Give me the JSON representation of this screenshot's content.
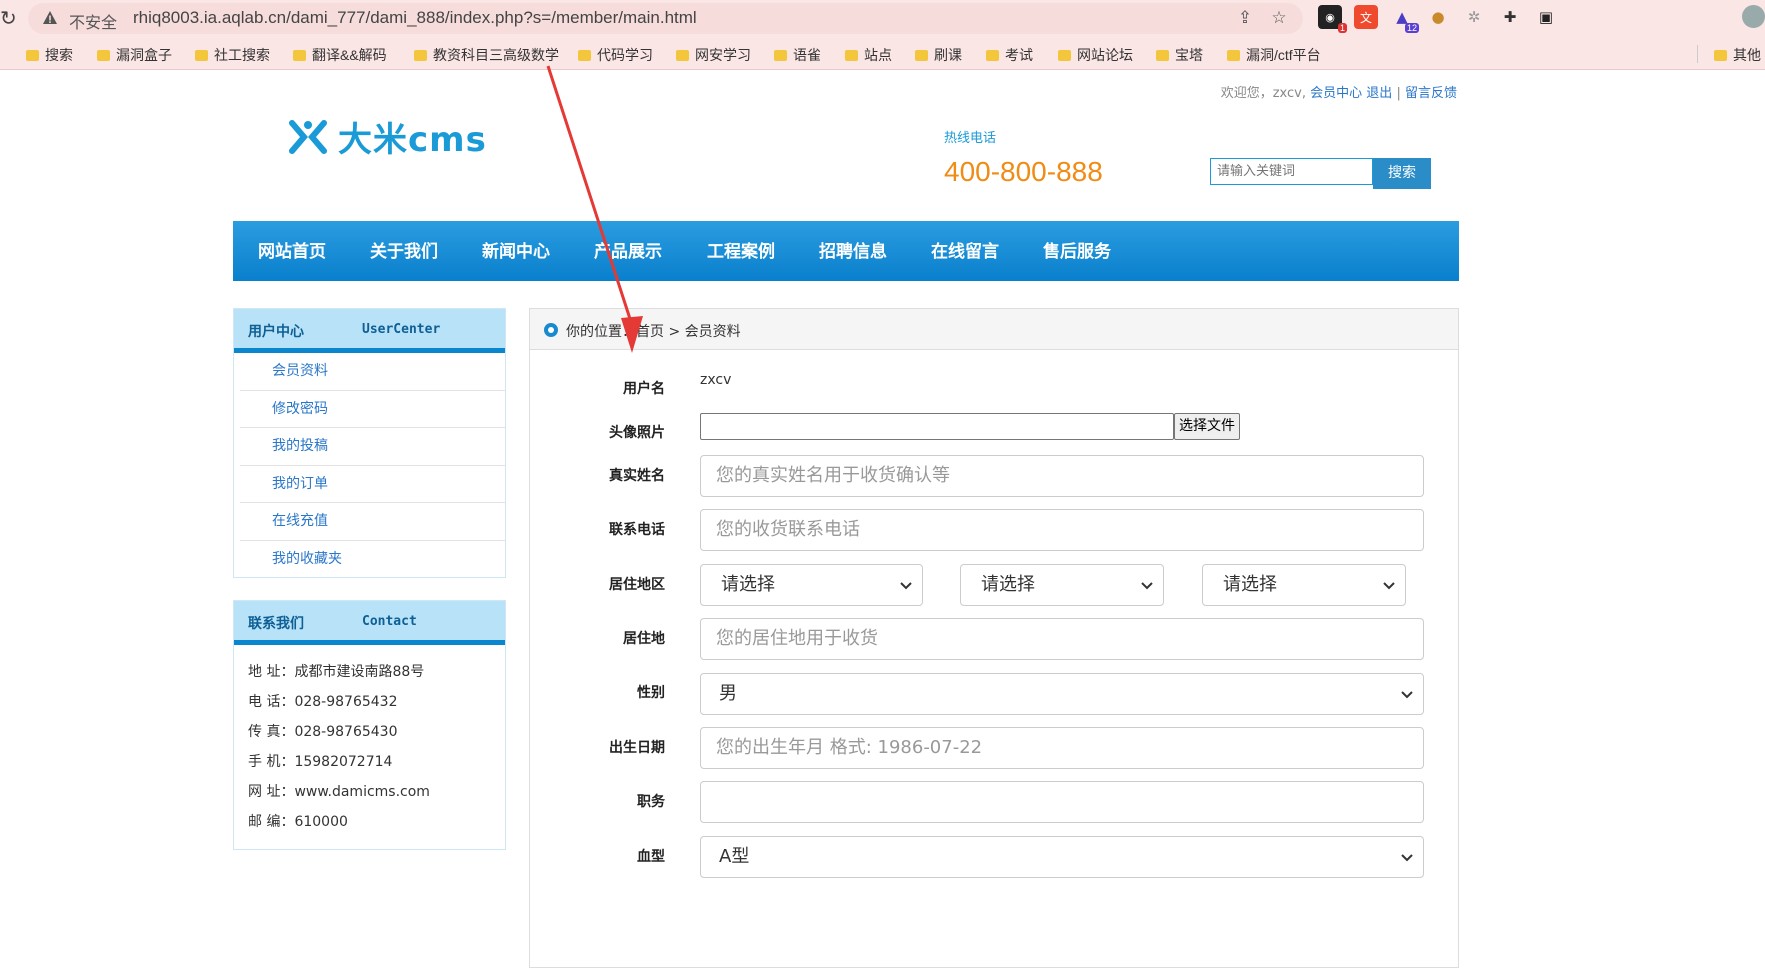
{
  "browser": {
    "insecure_label": "不安全",
    "url": "rhiq8003.ia.aqlab.cn/dami_777/dami_888/index.php?s=/member/main.html",
    "ext_badge_1": "1",
    "ext_badge_2": "12",
    "bookmarks": [
      "搜索",
      "漏洞盒子",
      "社工搜索",
      "翻译&&解码",
      "教资科目三高级数学",
      "代码学习",
      "网安学习",
      "语雀",
      "站点",
      "刷课",
      "考试",
      "网站论坛",
      "宝塔",
      "漏洞/ctf平台",
      "其他"
    ]
  },
  "header": {
    "welcome": "欢迎您，zxcv,",
    "member_center": "会员中心",
    "logout": "退出",
    "separator": "|",
    "feedback": "留言反馈",
    "logo_text": "大米cms",
    "hotline_label": "热线电话",
    "hotline_number": "400-800-888",
    "search_placeholder": "请输入关键词",
    "search_button": "搜索"
  },
  "nav": [
    "网站首页",
    "关于我们",
    "新闻中心",
    "产品展示",
    "工程案例",
    "招聘信息",
    "在线留言",
    "售后服务"
  ],
  "sidebar": {
    "user_center_cn": "用户中心",
    "user_center_en": "UserCenter",
    "items": [
      "会员资料",
      "修改密码",
      "我的投稿",
      "我的订单",
      "在线充值",
      "我的收藏夹"
    ],
    "contact_cn": "联系我们",
    "contact_en": "Contact",
    "contact_lines": [
      "地  址：成都市建设南路88号",
      "电  话：028-98765432",
      "传  真：028-98765430",
      "手  机：15982072714",
      "网  址：www.damicms.com",
      "邮  编：610000"
    ]
  },
  "breadcrumb": "你的位置：首页 > 会员资料",
  "form": {
    "username_label": "用户名",
    "username_value": "zxcv",
    "avatar_label": "头像照片",
    "file_button": "选择文件",
    "realname_label": "真实姓名",
    "realname_placeholder": "您的真实姓名用于收货确认等",
    "phone_label": "联系电话",
    "phone_placeholder": "您的收货联系电话",
    "region_label": "居住地区",
    "region_select_1": "请选择",
    "region_select_2": "请选择",
    "region_select_3": "请选择",
    "address_label": "居住地",
    "address_placeholder": "您的居住地用于收货",
    "gender_label": "性别",
    "gender_value": "男",
    "birth_label": "出生日期",
    "birth_placeholder": "您的出生年月 格式: 1986-07-22",
    "job_label": "职务",
    "job_value": "",
    "blood_label": "血型",
    "blood_value": "A型"
  },
  "colors": {
    "nav_blue": "#0a7fcc",
    "accent_orange": "#f08b14",
    "annotation_red": "#e53935"
  }
}
